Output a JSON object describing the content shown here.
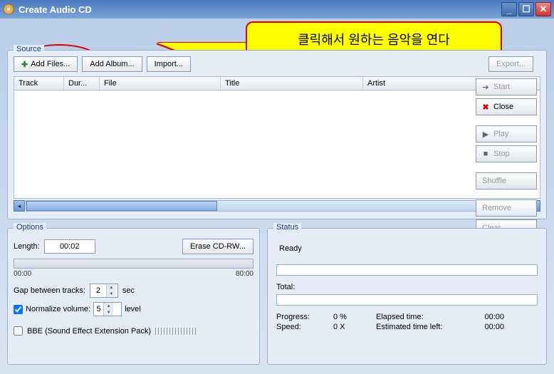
{
  "window": {
    "title": "Create Audio CD"
  },
  "callout": {
    "text": "클릭해서 원하는 음악을 연다"
  },
  "source": {
    "label": "Source",
    "add_files": "Add Files...",
    "add_album": "Add Album...",
    "import": "Import...",
    "export": "Export...",
    "columns": {
      "track": "Track",
      "dur": "Dur...",
      "file": "File",
      "title": "Title",
      "artist": "Artist"
    }
  },
  "side": {
    "start": "Start",
    "close": "Close",
    "play": "Play",
    "stop": "Stop",
    "shuffle": "Shuffle",
    "remove": "Remove",
    "clear": "Clear"
  },
  "options": {
    "label": "Options",
    "length_lbl": "Length:",
    "length_val": "00:02",
    "erase": "Erase CD-RW...",
    "scale_min": "00:00",
    "scale_max": "80:00",
    "gap_lbl": "Gap between tracks:",
    "gap_val": "2",
    "gap_unit": "sec",
    "norm_lbl": "Normalize volume:",
    "norm_val": "5",
    "norm_unit": "level",
    "bbe_lbl": "BBE (Sound Effect Extension Pack)"
  },
  "status": {
    "label": "Status",
    "ready": "Ready",
    "total": "Total:",
    "progress_lbl": "Progress:",
    "progress_val": "0 %",
    "speed_lbl": "Speed:",
    "speed_val": "0 X",
    "elapsed_lbl": "Elapsed time:",
    "elapsed_val": "00:00",
    "est_lbl": "Estimated time left:",
    "est_val": "00:00"
  }
}
